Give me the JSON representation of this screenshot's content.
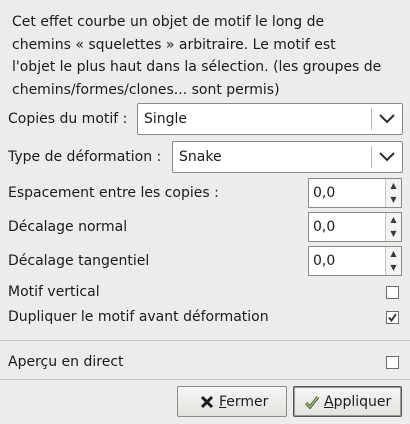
{
  "description": {
    "line1": "Cet effet courbe un objet de motif le long de",
    "line2": "chemins « squelettes » arbitraire. Le motif est",
    "line3": "l'objet le plus haut dans la sélection. (les groupes de",
    "line4": "chemins/formes/clones... sont permis)"
  },
  "copies": {
    "label": "Copies du motif :",
    "value": "Single"
  },
  "deformation": {
    "label": "Type de déformation :",
    "value": "Snake"
  },
  "spacing": {
    "label": "Espacement entre les copies :",
    "value": "0,0"
  },
  "normal_offset": {
    "label": "Décalage normal",
    "value": "0,0"
  },
  "tangential_offset": {
    "label": "Décalage tangentiel",
    "value": "0,0"
  },
  "vertical_pattern": {
    "label": "Motif vertical",
    "checked": false
  },
  "duplicate_pattern": {
    "label": "Dupliquer le motif avant déformation",
    "checked": true
  },
  "live_preview": {
    "label": "Aperçu en direct",
    "checked": false
  },
  "buttons": {
    "close_first": "F",
    "close_rest": "ermer",
    "apply_first": "A",
    "apply_rest": "ppliquer"
  },
  "icons": {
    "combo_arrow": "chevron-down-icon",
    "spin_up": "arrow-up-icon",
    "spin_down": "arrow-down-icon",
    "close": "close-icon",
    "apply": "checkmark-icon"
  }
}
